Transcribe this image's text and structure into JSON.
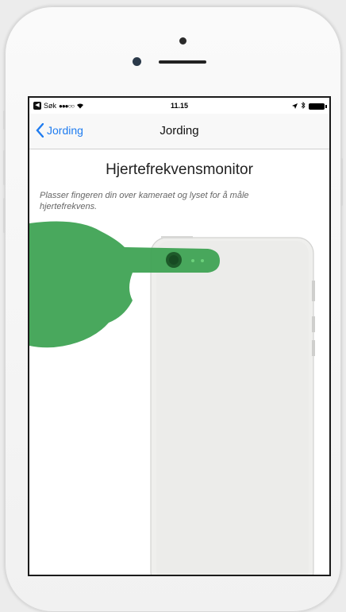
{
  "status_bar": {
    "back_app": "Søk",
    "signal": "●●●○○",
    "time": "11.15"
  },
  "nav": {
    "back_label": "Jording",
    "title": "Jording"
  },
  "content": {
    "title": "Hjertefrekvensmonitor",
    "instruction": "Plasser fingeren din over kameraet og lyset for å måle hjertefrekvens."
  },
  "colors": {
    "accent": "#1f7cf0",
    "finger_green": "#3aa14f"
  }
}
